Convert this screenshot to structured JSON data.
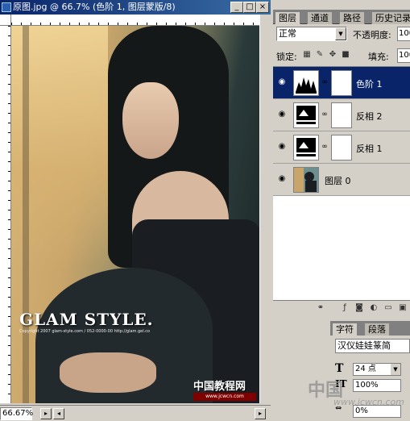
{
  "document": {
    "title": "原图.jpg @ 66.7% (色阶 1, 图层蒙版/8)",
    "controls": {
      "minimize": "_",
      "maximize": "□",
      "close": "×"
    },
    "artwork": {
      "glam_text": "GLAM STYLE.",
      "copyright_text": "Copyright 2007 glam-style.com / 052-0000-00 http://glam.gel.co",
      "watermark_name": "中国教程网",
      "watermark_url": "www.jcwcn.com"
    },
    "zoom": "66.67%"
  },
  "layers_panel": {
    "tabs": [
      "图层",
      "通道",
      "路径",
      "历史记录"
    ],
    "blend_mode": "正常",
    "opacity_label": "不透明度:",
    "opacity_value": "100",
    "lock_label": "锁定:",
    "fill_label": "填充:",
    "fill_value": "100",
    "layers": [
      {
        "name": "色阶 1",
        "selected": true
      },
      {
        "name": "反相 2",
        "selected": false
      },
      {
        "name": "反相 1",
        "selected": false
      },
      {
        "name": "图层 0",
        "selected": false
      }
    ]
  },
  "character_panel": {
    "tabs": [
      "字符",
      "段落"
    ],
    "font": "汉仪娃娃篆简",
    "size": "24 点",
    "scale": "100%",
    "tracking": "0%"
  },
  "site_watermark": {
    "logo": "中国",
    "url": "www.jcwcn.com"
  },
  "colors": {
    "title_bar": "#0a246a",
    "selected_layer": "#0a246a",
    "chrome": "#d4d0c8"
  }
}
